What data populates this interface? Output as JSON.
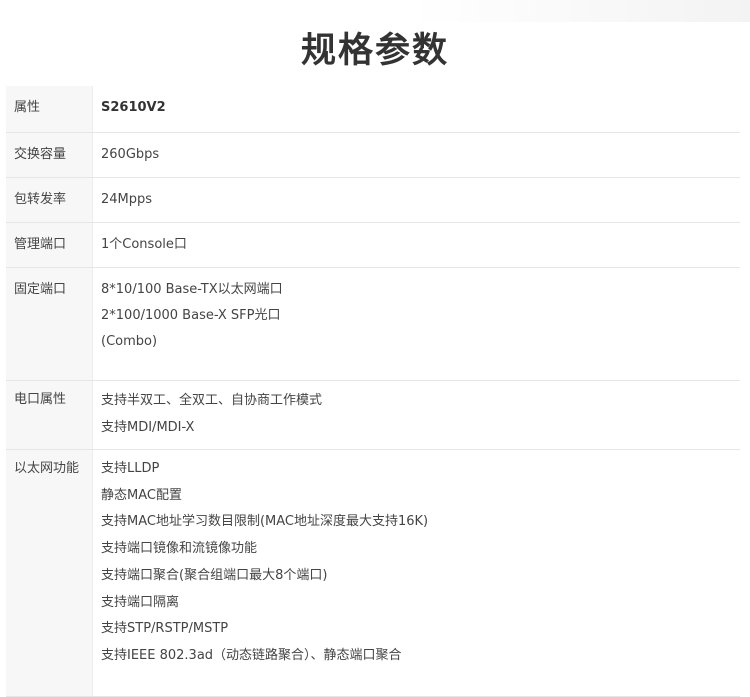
{
  "page_title": "规格参数",
  "table": {
    "header": {
      "label": "属性",
      "value": "S2610V2"
    },
    "rows": [
      {
        "label": "交换容量",
        "values": [
          "260Gbps"
        ]
      },
      {
        "label": "包转发率",
        "values": [
          "24Mpps"
        ]
      },
      {
        "label": "管理端口",
        "values": [
          "1个Console口"
        ]
      },
      {
        "label": "固定端口",
        "values": [
          "8*10/100 Base-TX以太网端口",
          "2*100/1000 Base-X SFP光口",
          "(Combo)"
        ]
      },
      {
        "label": "电口属性",
        "values": [
          "支持半双工、全双工、自协商工作模式",
          "支持MDI/MDI-X"
        ]
      },
      {
        "label": "以太网功能",
        "values": [
          "支持LLDP",
          "静态MAC配置",
          "支持MAC地址学习数目限制(MAC地址深度最大支持16K)",
          "支持端口镜像和流镜像功能",
          "支持端口聚合(聚合组端口最大8个端口)",
          "支持端口隔离",
          "支持STP/RSTP/MSTP",
          "支持IEEE 802.3ad（动态链路聚合）、静态端口聚合"
        ]
      }
    ]
  }
}
